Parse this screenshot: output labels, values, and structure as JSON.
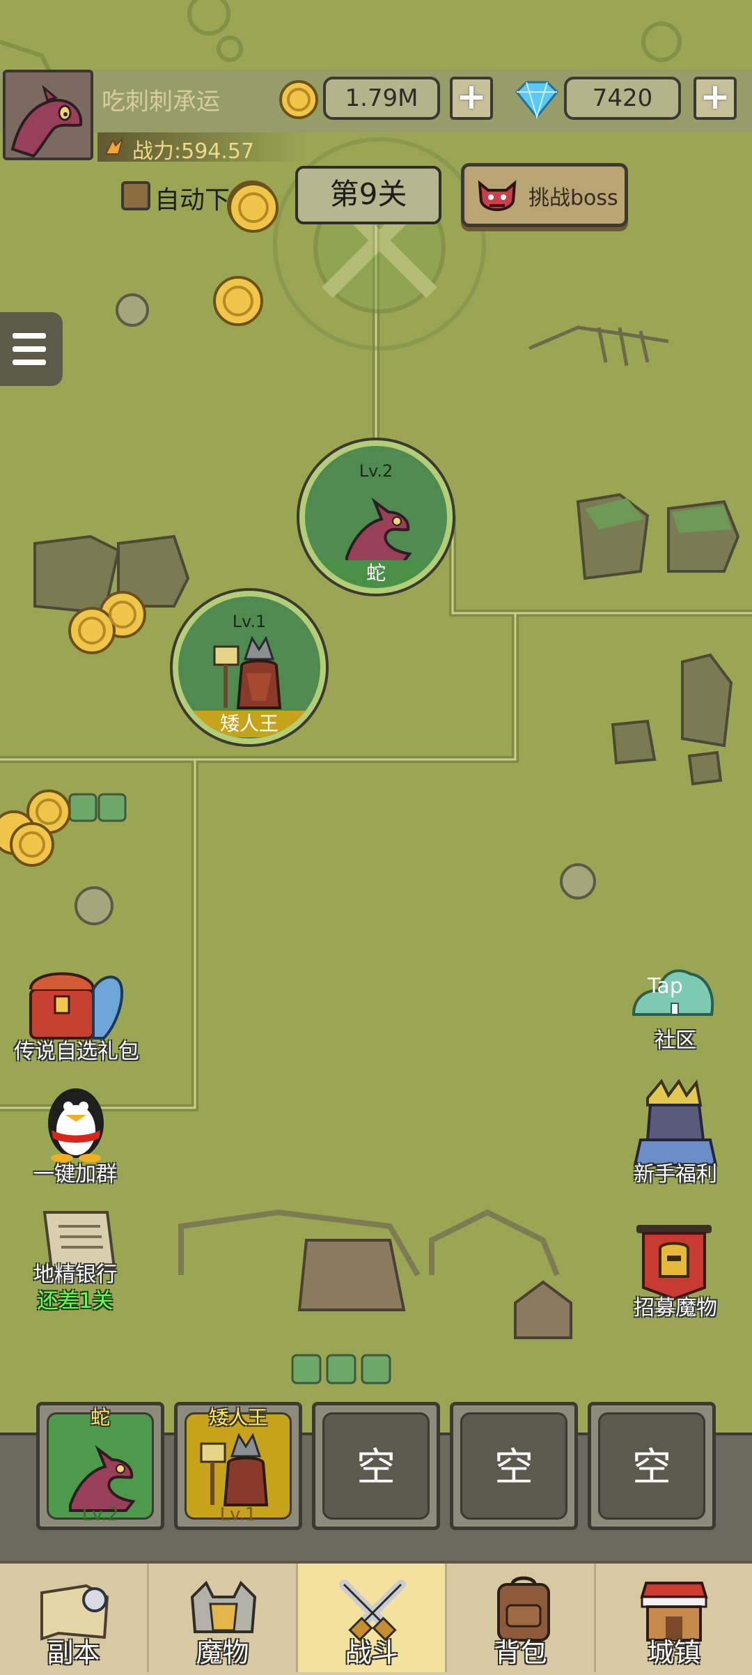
{
  "player": {
    "name": "吃刺刺承运",
    "power": "战力:594.57"
  },
  "currency": {
    "gold": "1.79M",
    "diamonds": "7420",
    "plus": "+"
  },
  "stage": {
    "auto_label": "自动下",
    "stage_label": "第9关",
    "boss_label": "挑战boss"
  },
  "map_monsters": [
    {
      "level": "Lv.2",
      "name": "蛇"
    },
    {
      "level": "Lv.1",
      "name": "矮人王"
    }
  ],
  "side_left": {
    "gift": "传说自选礼包",
    "group": "一键加群",
    "bank": "地精银行",
    "bank_sub": "还差1关"
  },
  "side_right": {
    "community": "社区",
    "tap": "Tap",
    "newbie": "新手福利",
    "recruit": "招募魔物"
  },
  "team": {
    "slots": [
      {
        "name": "蛇",
        "level": "Lv.2"
      },
      {
        "name": "矮人王",
        "level": "Lv.1"
      },
      {
        "empty": "空"
      },
      {
        "empty": "空"
      },
      {
        "empty": "空"
      }
    ]
  },
  "nav": {
    "items": [
      {
        "label": "副本"
      },
      {
        "label": "魔物"
      },
      {
        "label": "战斗"
      },
      {
        "label": "背包"
      },
      {
        "label": "城镇"
      }
    ]
  },
  "colors": {
    "map_bg": "#9aa654",
    "active_tab": "#f3e29d",
    "monster_green": "#4f8a50",
    "gold_band": "#c7a21b"
  }
}
